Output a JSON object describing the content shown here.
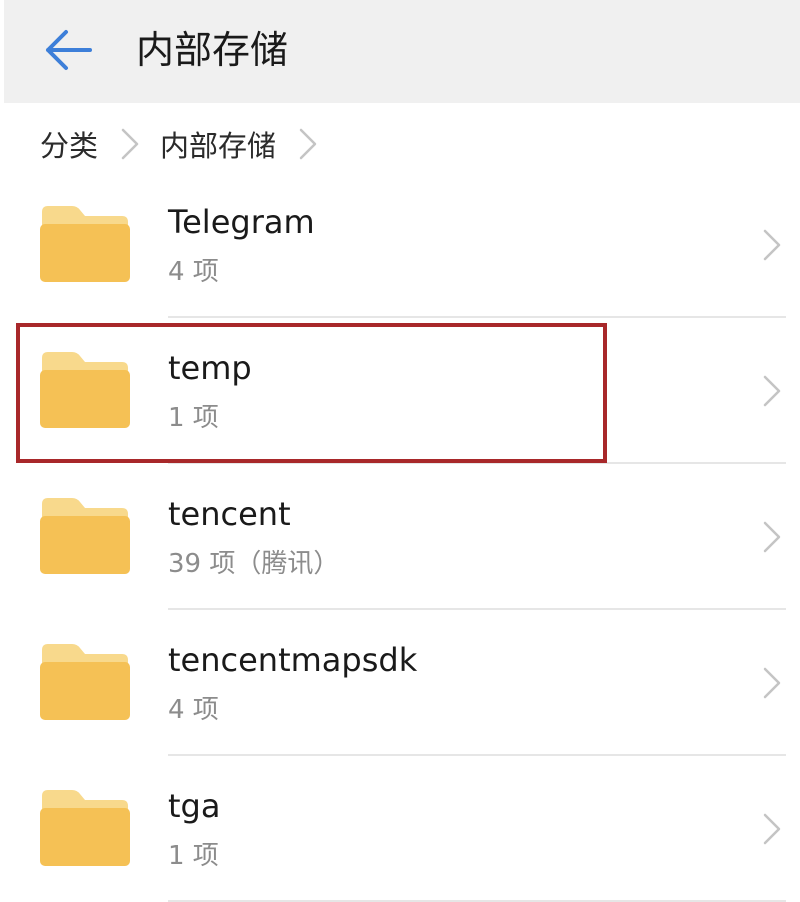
{
  "header": {
    "back_icon": "arrow-left-icon",
    "accent_color": "#3d7fd9",
    "title": "内部存储"
  },
  "breadcrumb": {
    "items": [
      {
        "label": "分类"
      },
      {
        "label": "内部存储"
      }
    ]
  },
  "folder_color": "#f5c155",
  "files": [
    {
      "name": "Telegram",
      "meta": "4 项"
    },
    {
      "name": "temp",
      "meta": "1 项",
      "highlighted": true
    },
    {
      "name": "tencent",
      "meta": "39 项（腾讯）"
    },
    {
      "name": "tencentmapsdk",
      "meta": "4 项"
    },
    {
      "name": "tga",
      "meta": "1 项"
    }
  ],
  "highlight_color": "#a8282a"
}
